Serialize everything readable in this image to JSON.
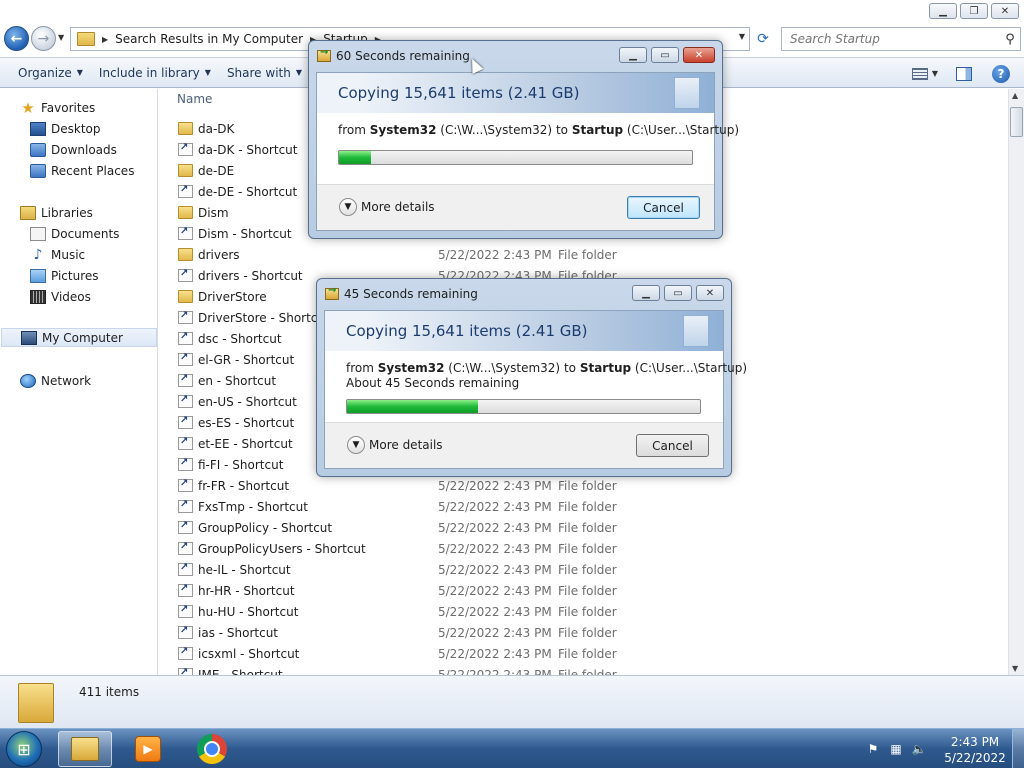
{
  "window": {
    "minimize_icon": "minimize-icon",
    "maximize_icon": "restore-icon",
    "close_icon": "close-icon"
  },
  "address": {
    "crumbs": [
      "Search Results in My Computer",
      "Startup"
    ],
    "search_placeholder": "Search Startup"
  },
  "toolbar": {
    "organize": "Organize",
    "include": "Include in library",
    "share": "Share with"
  },
  "sidebar": {
    "favorites": "Favorites",
    "desktop": "Desktop",
    "downloads": "Downloads",
    "recent": "Recent Places",
    "libraries": "Libraries",
    "documents": "Documents",
    "music": "Music",
    "pictures": "Pictures",
    "videos": "Videos",
    "computer": "My Computer",
    "network": "Network"
  },
  "list": {
    "col_name": "Name",
    "rows": [
      {
        "name": "da-DK",
        "type_icon": "folder",
        "date": "",
        "kind": ""
      },
      {
        "name": "da-DK - Shortcut",
        "type_icon": "shortcut",
        "date": "",
        "kind": ""
      },
      {
        "name": "de-DE",
        "type_icon": "folder",
        "date": "",
        "kind": ""
      },
      {
        "name": "de-DE - Shortcut",
        "type_icon": "shortcut",
        "date": "",
        "kind": ""
      },
      {
        "name": "Dism",
        "type_icon": "folder",
        "date": "",
        "kind": ""
      },
      {
        "name": "Dism - Shortcut",
        "type_icon": "shortcut",
        "date": "",
        "kind": ""
      },
      {
        "name": "drivers",
        "type_icon": "folder",
        "date": "5/22/2022 2:43 PM",
        "kind": "File folder"
      },
      {
        "name": "drivers - Shortcut",
        "type_icon": "shortcut",
        "date": "5/22/2022 2:43 PM",
        "kind": "File folder"
      },
      {
        "name": "DriverStore",
        "type_icon": "folder",
        "date": "",
        "kind": ""
      },
      {
        "name": "DriverStore - Shortcut",
        "type_icon": "shortcut",
        "date": "",
        "kind": ""
      },
      {
        "name": "dsc - Shortcut",
        "type_icon": "shortcut",
        "date": "",
        "kind": ""
      },
      {
        "name": "el-GR - Shortcut",
        "type_icon": "shortcut",
        "date": "",
        "kind": ""
      },
      {
        "name": "en - Shortcut",
        "type_icon": "shortcut",
        "date": "",
        "kind": ""
      },
      {
        "name": "en-US - Shortcut",
        "type_icon": "shortcut",
        "date": "",
        "kind": ""
      },
      {
        "name": "es-ES - Shortcut",
        "type_icon": "shortcut",
        "date": "",
        "kind": ""
      },
      {
        "name": "et-EE - Shortcut",
        "type_icon": "shortcut",
        "date": "",
        "kind": ""
      },
      {
        "name": "fi-FI - Shortcut",
        "type_icon": "shortcut",
        "date": "",
        "kind": ""
      },
      {
        "name": "fr-FR - Shortcut",
        "type_icon": "shortcut",
        "date": "5/22/2022 2:43 PM",
        "kind": "File folder"
      },
      {
        "name": "FxsTmp - Shortcut",
        "type_icon": "shortcut",
        "date": "5/22/2022 2:43 PM",
        "kind": "File folder"
      },
      {
        "name": "GroupPolicy - Shortcut",
        "type_icon": "shortcut",
        "date": "5/22/2022 2:43 PM",
        "kind": "File folder"
      },
      {
        "name": "GroupPolicyUsers - Shortcut",
        "type_icon": "shortcut",
        "date": "5/22/2022 2:43 PM",
        "kind": "File folder"
      },
      {
        "name": "he-IL - Shortcut",
        "type_icon": "shortcut",
        "date": "5/22/2022 2:43 PM",
        "kind": "File folder"
      },
      {
        "name": "hr-HR - Shortcut",
        "type_icon": "shortcut",
        "date": "5/22/2022 2:43 PM",
        "kind": "File folder"
      },
      {
        "name": "hu-HU - Shortcut",
        "type_icon": "shortcut",
        "date": "5/22/2022 2:43 PM",
        "kind": "File folder"
      },
      {
        "name": "ias - Shortcut",
        "type_icon": "shortcut",
        "date": "5/22/2022 2:43 PM",
        "kind": "File folder"
      },
      {
        "name": "icsxml - Shortcut",
        "type_icon": "shortcut",
        "date": "5/22/2022 2:43 PM",
        "kind": "File folder"
      },
      {
        "name": "IME - Shortcut",
        "type_icon": "shortcut",
        "date": "5/22/2022 2:43 PM",
        "kind": "File folder"
      }
    ]
  },
  "status": {
    "count": "411 items"
  },
  "dialog1": {
    "title": "60 Seconds remaining",
    "heading": "Copying 15,641 items (2.41 GB)",
    "from_word": "from",
    "src_name": "System32",
    "src_path": "(C:\\W...\\System32)",
    "to_word": "to",
    "dst_name": "Startup",
    "dst_path": "(C:\\User...\\Startup)",
    "progress_fraction": 0.09,
    "more": "More details",
    "cancel": "Cancel"
  },
  "dialog2": {
    "title": "45 Seconds remaining",
    "heading": "Copying 15,641 items (2.41 GB)",
    "from_word": "from",
    "src_name": "System32",
    "src_path": "(C:\\W...\\System32)",
    "to_word": "to",
    "dst_name": "Startup",
    "dst_path": "(C:\\User...\\Startup)",
    "remaining": "About 45 Seconds remaining",
    "progress_fraction": 0.37,
    "more": "More details",
    "cancel": "Cancel"
  },
  "taskbar": {
    "time": "2:43 PM",
    "date": "5/22/2022"
  }
}
